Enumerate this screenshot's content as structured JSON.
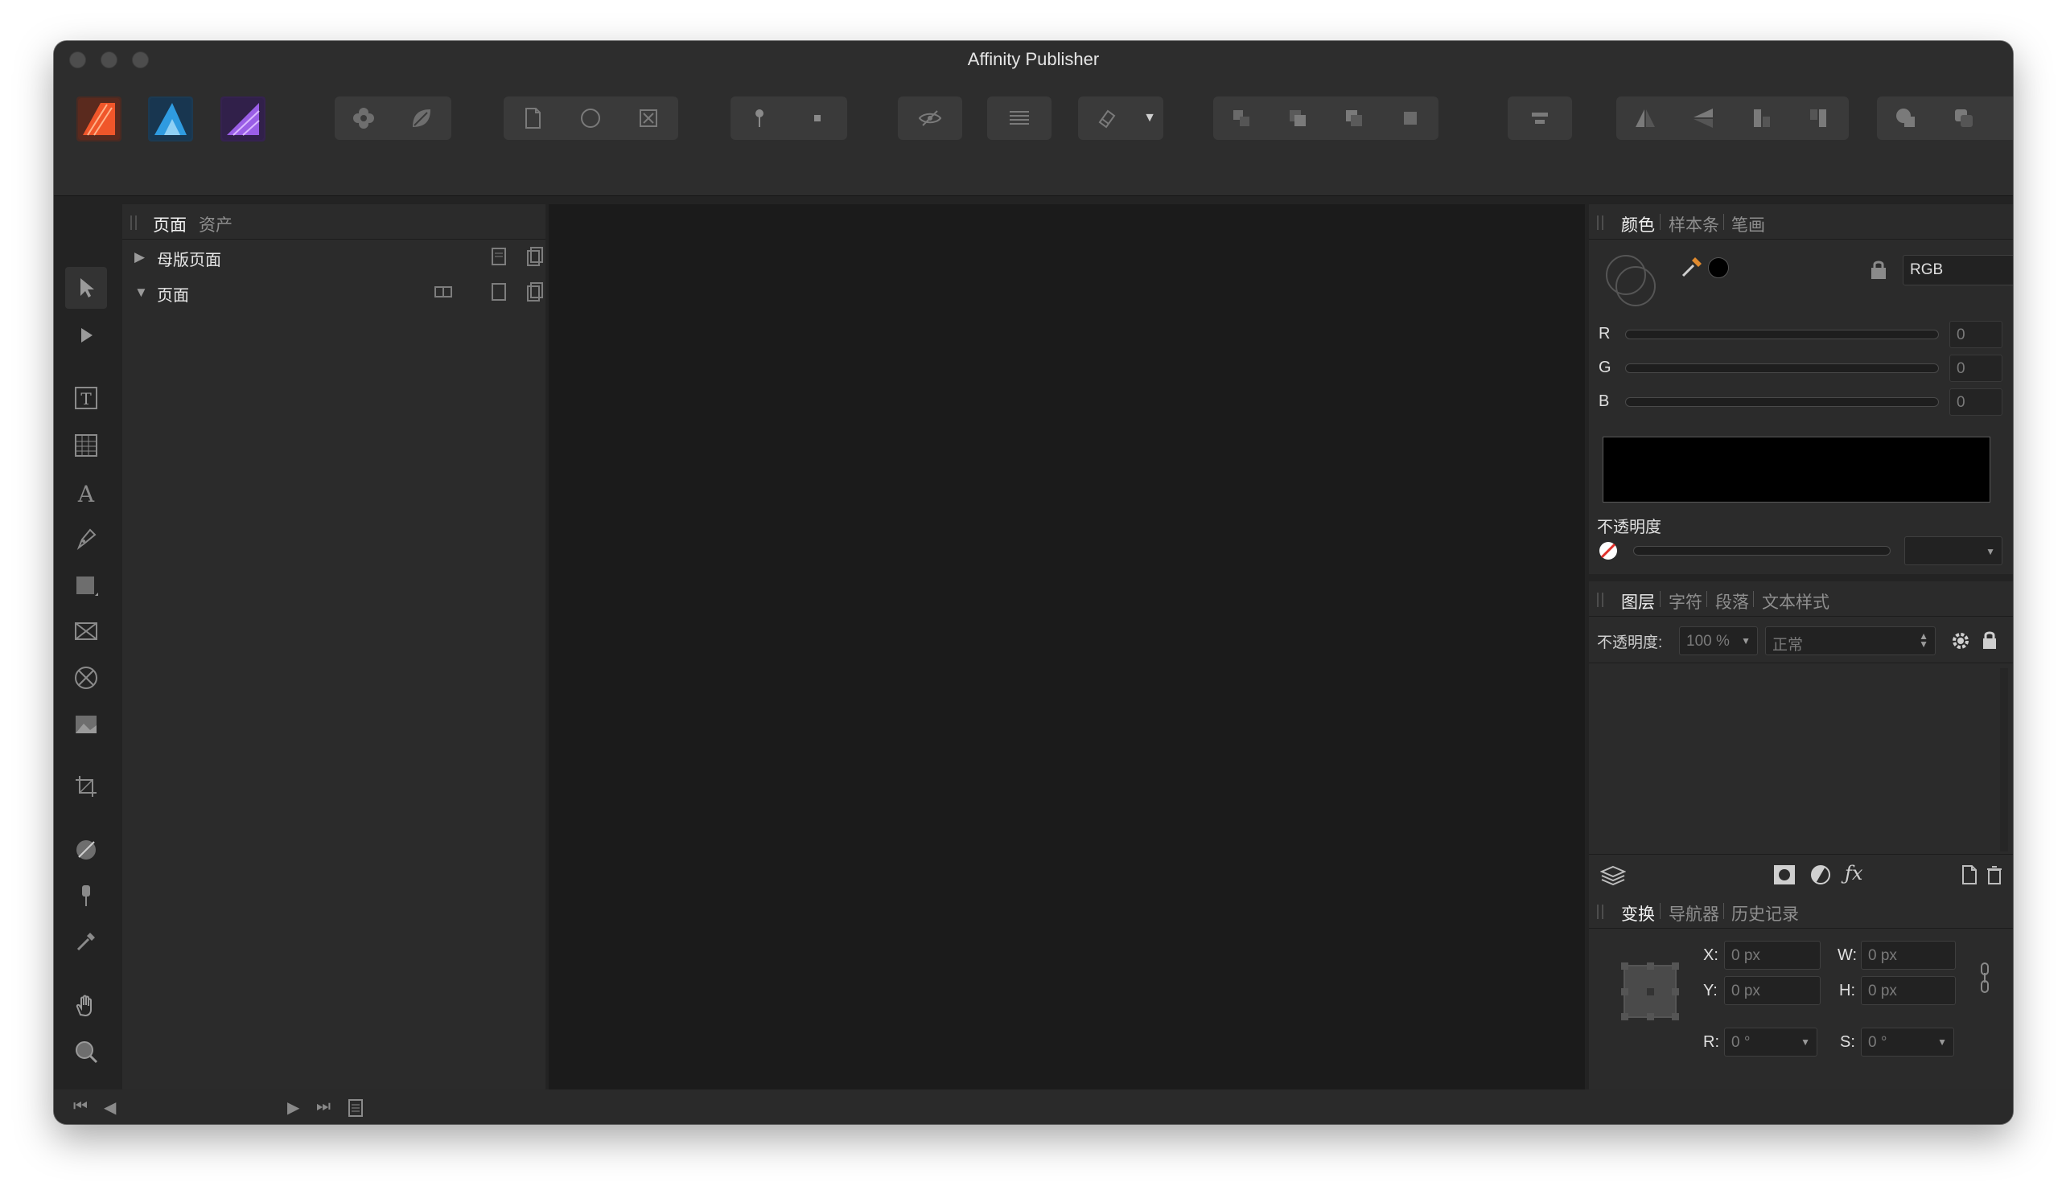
{
  "window": {
    "title": "Affinity Publisher"
  },
  "personas": [
    {
      "name": "publisher-persona",
      "color": "#f04b2f"
    },
    {
      "name": "designer-persona",
      "color": "#2a93d8"
    },
    {
      "name": "photo-persona",
      "color": "#8a4ee0"
    }
  ],
  "pages_panel": {
    "tabs": [
      "页面",
      "资产"
    ],
    "active_tab": "页面",
    "rows": [
      {
        "label": "母版页面",
        "expanded": false
      },
      {
        "label": "页面",
        "expanded": true
      }
    ]
  },
  "color_panel": {
    "tabs": [
      "颜色",
      "样本条",
      "笔画"
    ],
    "active_tab": "颜色",
    "model": "RGB",
    "channels": [
      {
        "name": "R",
        "value": "0"
      },
      {
        "name": "G",
        "value": "0"
      },
      {
        "name": "B",
        "value": "0"
      }
    ],
    "opacity_label": "不透明度"
  },
  "layers_panel": {
    "tabs": [
      "图层",
      "字符",
      "段落",
      "文本样式"
    ],
    "active_tab": "图层",
    "opacity_label": "不透明度:",
    "opacity_value": "100 %",
    "blend_mode": "正常"
  },
  "transform_panel": {
    "tabs": [
      "变换",
      "导航器",
      "历史记录"
    ],
    "active_tab": "变换",
    "fields": {
      "x_label": "X:",
      "x_value": "0 px",
      "y_label": "Y:",
      "y_value": "0 px",
      "w_label": "W:",
      "w_value": "0 px",
      "h_label": "H:",
      "h_value": "0 px",
      "r_label": "R:",
      "r_value": "0 °",
      "s_label": "S:",
      "s_value": "0 °"
    }
  }
}
